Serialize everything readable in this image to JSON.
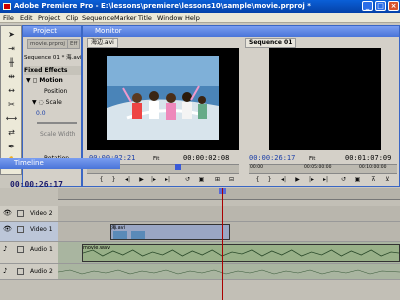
{
  "app": {
    "title": "Adobe Premiere Pro - E:\\lessons\\premiere\\lessons10\\sample\\movie.prproj *",
    "minimize": "_",
    "maximize": "□",
    "close": "×"
  },
  "menu": [
    "File",
    "Edit",
    "Project",
    "Clip",
    "Sequence",
    "Marker",
    "Title",
    "Window",
    "Help"
  ],
  "project": {
    "title": "Project",
    "tabs": [
      "movie.prproj",
      "Eff"
    ],
    "sequence_label": "Sequence 01 * 海.avi",
    "fixed_effects": "Fixed Effects",
    "motion": "Motion",
    "position": "Position",
    "scale": "Scale",
    "scale_value": "0.0",
    "scale_width": "Scale Width",
    "rotation": "Rotation",
    "timeline_title": "Timeline"
  },
  "monitor": {
    "title": "Monitor",
    "source_tab": "海边.avi",
    "program_tab": "Sequence 01",
    "source_tc_in": "00:00:02:21",
    "source_tc_dur": "00:00:02:08",
    "source_fit": "Fit",
    "program_tc_in": "00:00:26:17",
    "program_tc_dur": "00:01:07:09",
    "program_fit": "Fit",
    "program_ruler_start": "00:00",
    "program_ruler_mid": "00:05:00:00",
    "program_ruler_end": "00:10:00:00"
  },
  "timeline": {
    "current_time": "00:00:26:17",
    "tracks": [
      {
        "name": "Video 2",
        "type": "video"
      },
      {
        "name": "Video 1",
        "type": "video",
        "clip": "海.avi"
      },
      {
        "name": "Audio 1",
        "type": "audio",
        "clip": "movie.wav"
      },
      {
        "name": "Audio 2",
        "type": "audio"
      }
    ]
  }
}
